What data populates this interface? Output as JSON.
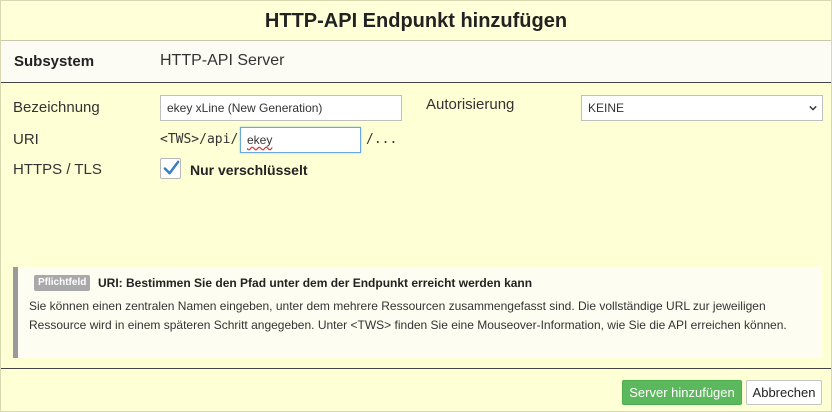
{
  "dialog": {
    "title": "HTTP-API Endpunkt hinzufügen"
  },
  "subsystem": {
    "label": "Subsystem",
    "value": "HTTP-API Server"
  },
  "form": {
    "bezeichnung_label": "Bezeichnung",
    "bezeichnung_value": "ekey xLine (New Generation)",
    "autorisierung_label": "Autorisierung",
    "autorisierung_value": "KEINE",
    "uri_label": "URI",
    "uri_prefix": "<TWS>/api/",
    "uri_value": "ekey",
    "uri_suffix": "/...",
    "https_label": "HTTPS / TLS",
    "https_checkbox_label": "Nur verschlüsselt",
    "https_checked": true
  },
  "hint": {
    "badge": "Pflichtfeld",
    "title": "URI: Bestimmen Sie den Pfad unter dem der Endpunkt erreicht werden kann",
    "text": "Sie können einen zentralen Namen eingeben, unter dem mehrere Ressourcen zusammengefasst sind. Die vollständige URL zur jeweiligen Ressource wird in einem späteren Schritt angegeben. Unter <TWS> finden Sie eine Mouseover-Information, wie Sie die API erreichen können."
  },
  "buttons": {
    "add_server": "Server hinzufügen",
    "cancel": "Abbrechen"
  },
  "colors": {
    "background": "#ffffd6",
    "primary_button": "#5cb85c",
    "checkmark": "#3a7fc1"
  }
}
